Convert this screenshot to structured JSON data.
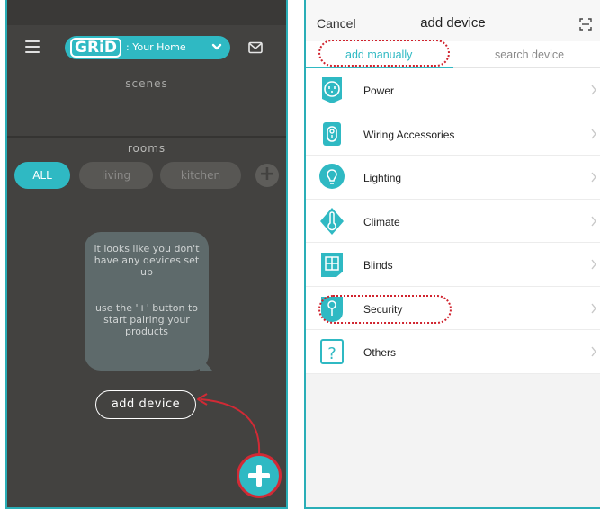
{
  "left_screen": {
    "brand": "GRiD",
    "home_selector": ": Your Home",
    "scenes_title": "scenes",
    "rooms_title": "rooms",
    "rooms": [
      "ALL",
      "living",
      "kitchen"
    ],
    "add_room_symbol": "+",
    "empty_message_1": "it looks like you don't have any devices set up",
    "empty_message_2": "use the '+' button to start pairing your products",
    "add_device_label": "add device",
    "colors": {
      "accent": "#2fb9c3",
      "background": "#434240",
      "highlight": "#d12a35"
    }
  },
  "right_screen": {
    "cancel_label": "Cancel",
    "title": "add device",
    "tabs": [
      "add manually",
      "search device"
    ],
    "categories": [
      "Power",
      "Wiring Accessories",
      "Lighting",
      "Climate",
      "Blinds",
      "Security",
      "Others"
    ],
    "icons": [
      "power-outlet-icon",
      "switch-icon",
      "bulb-icon",
      "thermometer-icon",
      "window-icon",
      "lock-icon",
      "question-icon"
    ]
  }
}
